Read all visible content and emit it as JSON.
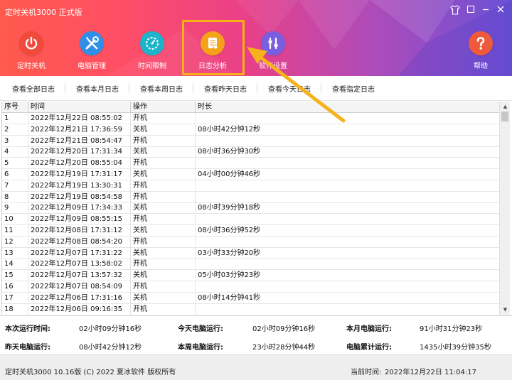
{
  "app": {
    "title": "定时关机3000 正式版"
  },
  "toolbar": {
    "items": [
      {
        "label": "定时关机",
        "icon": "power-icon",
        "color": "#ef4a3c"
      },
      {
        "label": "电脑管理",
        "icon": "tools-icon",
        "color": "#2f8fe8"
      },
      {
        "label": "时间限制",
        "icon": "timer-icon",
        "color": "#1cb4c9"
      },
      {
        "label": "日志分析",
        "icon": "document-icon",
        "color": "#f5a21a"
      },
      {
        "label": "软件设置",
        "icon": "settings-icon",
        "color": "#7a5ee0"
      },
      {
        "label": "帮助",
        "icon": "help-icon",
        "color": "#ef5a3c"
      }
    ],
    "active_index": 3
  },
  "subnav": {
    "items": [
      "查看全部日志",
      "查看本月日志",
      "查看本周日志",
      "查看昨天日志",
      "查看今天日志",
      "查看指定日志"
    ]
  },
  "table": {
    "columns": [
      "序号",
      "时间",
      "操作",
      "时长"
    ],
    "rows": [
      [
        "1",
        "2022年12月22日 08:55:02",
        "开机",
        ""
      ],
      [
        "2",
        "2022年12月21日 17:36:59",
        "关机",
        "08小时42分钟12秒"
      ],
      [
        "3",
        "2022年12月21日 08:54:47",
        "开机",
        ""
      ],
      [
        "4",
        "2022年12月20日 17:31:34",
        "关机",
        "08小时36分钟30秒"
      ],
      [
        "5",
        "2022年12月20日 08:55:04",
        "开机",
        ""
      ],
      [
        "6",
        "2022年12月19日 17:31:17",
        "关机",
        "04小时00分钟46秒"
      ],
      [
        "7",
        "2022年12月19日 13:30:31",
        "开机",
        ""
      ],
      [
        "8",
        "2022年12月19日 08:54:58",
        "开机",
        ""
      ],
      [
        "9",
        "2022年12月09日 17:34:33",
        "关机",
        "08小时39分钟18秒"
      ],
      [
        "10",
        "2022年12月09日 08:55:15",
        "开机",
        ""
      ],
      [
        "11",
        "2022年12月08日 17:31:12",
        "关机",
        "08小时36分钟52秒"
      ],
      [
        "12",
        "2022年12月08日 08:54:20",
        "开机",
        ""
      ],
      [
        "13",
        "2022年12月07日 17:31:22",
        "关机",
        "03小时33分钟20秒"
      ],
      [
        "14",
        "2022年12月07日 13:58:02",
        "开机",
        ""
      ],
      [
        "15",
        "2022年12月07日 13:57:32",
        "关机",
        "05小时03分钟23秒"
      ],
      [
        "16",
        "2022年12月07日 08:54:09",
        "开机",
        ""
      ],
      [
        "17",
        "2022年12月06日 17:31:16",
        "关机",
        "08小时14分钟41秒"
      ],
      [
        "18",
        "2022年12月06日 09:16:35",
        "开机",
        ""
      ]
    ]
  },
  "stats": {
    "current_run_label": "本次运行时间:",
    "current_run_value": "02小时09分钟16秒",
    "today_label": "今天电脑运行:",
    "today_value": "02小时09分钟16秒",
    "month_label": "本月电脑运行:",
    "month_value": "91小时31分钟23秒",
    "yesterday_label": "昨天电脑运行:",
    "yesterday_value": "08小时42分钟12秒",
    "week_label": "本周电脑运行:",
    "week_value": "23小时28分钟44秒",
    "total_label": "电脑累计运行:",
    "total_value": "1435小时39分钟35秒"
  },
  "footer": {
    "copyright": "定时关机3000 10.16版 (C) 2022  夏冰软件 版权所有",
    "current_time_label": "当前时间:",
    "current_time": "2022年12月22日 11:04:17"
  },
  "colors": {
    "highlight": "#f7b016",
    "arrow": "#f5b21c"
  }
}
